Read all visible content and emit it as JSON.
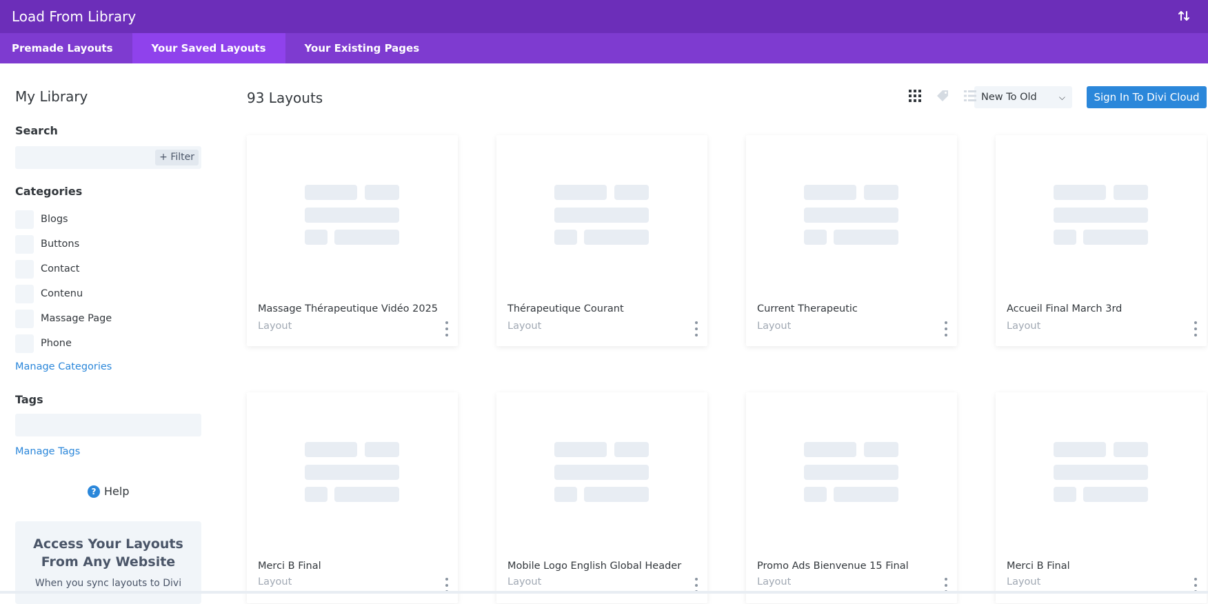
{
  "header": {
    "title": "Load From Library",
    "sort_icon": "sort-arrows-icon"
  },
  "tabs": [
    {
      "label": "Premade Layouts",
      "active": false
    },
    {
      "label": "Your Saved Layouts",
      "active": true
    },
    {
      "label": "Your Existing Pages",
      "active": false
    }
  ],
  "sidebar": {
    "title": "My Library",
    "search_label": "Search",
    "filter_label": "+ Filter",
    "categories_label": "Categories",
    "categories": [
      "Blogs",
      "Buttons",
      "Contact",
      "Contenu",
      "Massage Page",
      "Phone"
    ],
    "manage_categories": "Manage Categories",
    "tags_label": "Tags",
    "manage_tags": "Manage Tags",
    "help_label": "Help",
    "promo_title": "Access Your Layouts From Any Website",
    "promo_text": "When you sync layouts to Divi"
  },
  "main": {
    "count": "93 Layouts",
    "sort_value": "New To Old",
    "signin_label": "Sign In To Divi Cloud",
    "accent_color": "#2b87da",
    "header_color": "#6c2eb9",
    "tabs_color": "#7e3bd0",
    "cards": [
      {
        "title": "Massage Thérapeutique Vidéo 2025",
        "type": "Layout"
      },
      {
        "title": "Thérapeutique Courant",
        "type": "Layout"
      },
      {
        "title": "Current Therapeutic",
        "type": "Layout"
      },
      {
        "title": "Accueil Final March 3rd",
        "type": "Layout"
      },
      {
        "title": "Merci B Final",
        "type": "Layout"
      },
      {
        "title": "Mobile Logo English Global Header",
        "type": "Layout"
      },
      {
        "title": "Promo Ads Bienvenue 15 Final",
        "type": "Layout"
      },
      {
        "title": "Merci B Final",
        "type": "Layout"
      }
    ]
  }
}
